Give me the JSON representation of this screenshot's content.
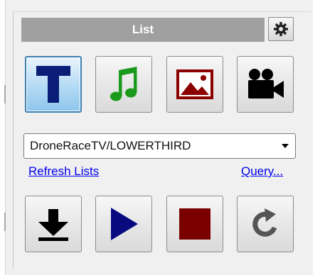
{
  "panel": {
    "title": "List",
    "settings_icon": "gear-icon"
  },
  "media_types": [
    {
      "name": "text",
      "icon": "text-t-icon",
      "selected": true,
      "color": "#0a1e78"
    },
    {
      "name": "audio",
      "icon": "music-note-icon",
      "selected": false,
      "color": "#1a9a1a"
    },
    {
      "name": "image",
      "icon": "picture-icon",
      "selected": false,
      "color": "#8b0000"
    },
    {
      "name": "video",
      "icon": "video-camera-icon",
      "selected": false,
      "color": "#000000"
    }
  ],
  "list_select": {
    "value": "DroneRaceTV/LOWERTHIRD"
  },
  "links": {
    "refresh": "Refresh Lists",
    "query": "Query..."
  },
  "transport": [
    {
      "name": "load",
      "icon": "download-arrow-icon",
      "color": "#000000"
    },
    {
      "name": "play",
      "icon": "play-icon",
      "color": "#0a0a80"
    },
    {
      "name": "stop",
      "icon": "stop-icon",
      "color": "#7a0000"
    },
    {
      "name": "refresh",
      "icon": "rotate-icon",
      "color": "#555555"
    }
  ]
}
